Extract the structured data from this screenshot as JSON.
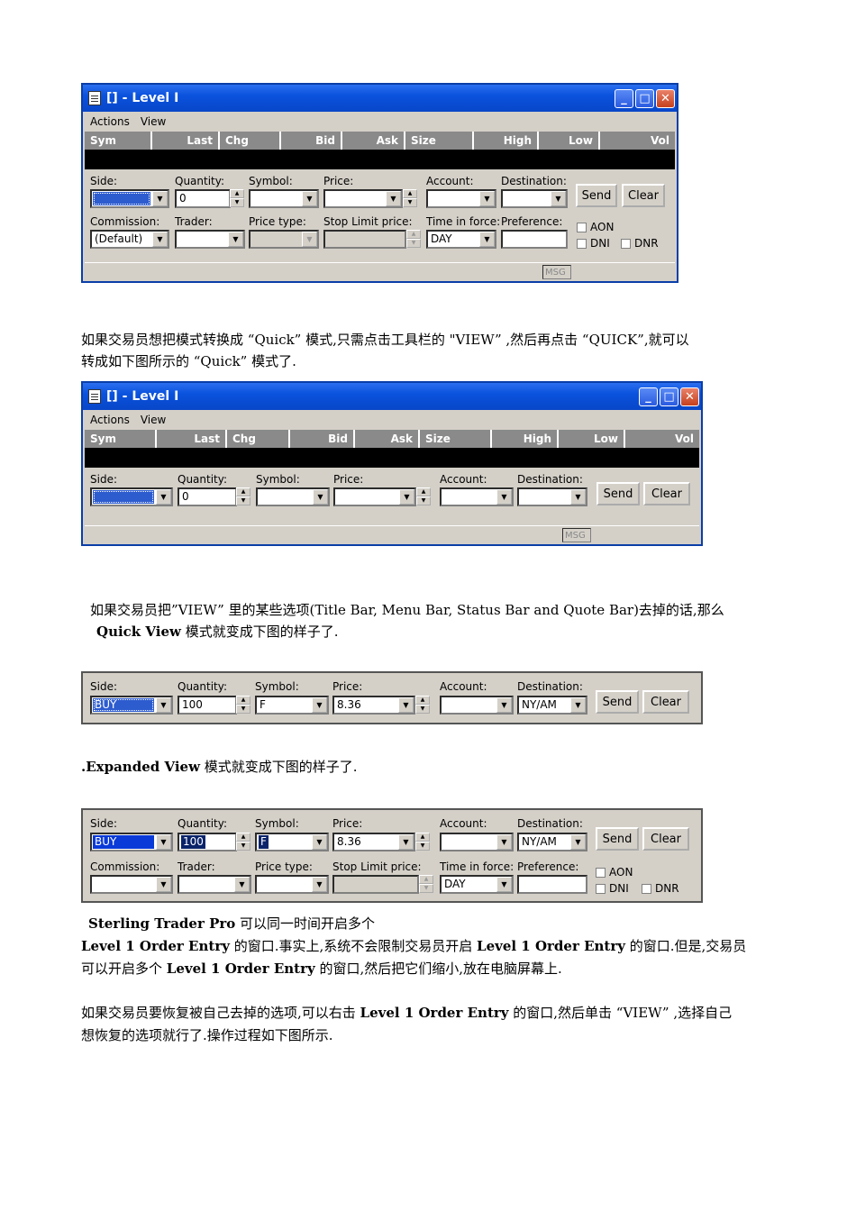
{
  "window": {
    "title": "[] - Level I",
    "menu": [
      "Actions",
      "View"
    ],
    "quote_columns": [
      "Sym",
      "Last",
      "Chg",
      "Bid",
      "Ask",
      "Size",
      "High",
      "Low",
      "Vol"
    ],
    "status_msg": "MSG"
  },
  "form": {
    "side_label": "Side:",
    "quantity_label": "Quantity:",
    "symbol_label": "Symbol:",
    "price_label": "Price:",
    "account_label": "Account:",
    "destination_label": "Destination:",
    "commission_label": "Commission:",
    "trader_label": "Trader:",
    "price_type_label": "Price type:",
    "stop_limit_label": "Stop Limit price:",
    "tif_label": "Time in force:",
    "preference_label": "Preference:",
    "send_label": "Send",
    "clear_label": "Clear",
    "aon_label": "AON",
    "dni_label": "DNI",
    "dnr_label": "DNR",
    "default_quantity": "0",
    "default_commission": "(Default)",
    "default_tif": "DAY"
  },
  "filled": {
    "side": "BUY",
    "quantity": "100",
    "symbol": "F",
    "price": "8.36",
    "destination": "NY/AM",
    "tif": "DAY"
  },
  "text": {
    "p1a": "如果交易员想把模式转换成 “Quick”   模式,只需点击工具栏的 \"VIEW” ,然后再点击 “QUICK”,就可以",
    "p1b": "转成如下图所示的 “Quick”   模式了.",
    "p2a": "如果交易员把”VIEW”    里的某些选项(Title Bar, Menu Bar, Status Bar and Quote Bar)去掉的话,那么",
    "p2b_bold": "Quick View",
    "p2b_rest": " 模式就变成下图的样子了.",
    "p3_bold": ".Expanded View",
    "p3_rest": " 模式就变成下图的样子了.",
    "p4_bold1": "Sterling Trader Pro",
    "p4_rest1": " 可以同一时间开启多个",
    "p4b_bold1": "Level 1 Order Entry",
    "p4b_mid": " 的窗口.事实上,系统不会限制交易员开启 ",
    "p4b_bold2": "Level 1 Order Entry",
    "p4b_rest": " 的窗口.但是,交易员",
    "p4c_pre": "可以开启多个 ",
    "p4c_bold": "Level 1 Order Entry",
    "p4c_rest": " 的窗口,然后把它们缩小,放在电脑屏幕上.",
    "p5a_pre": "如果交易员要恢复被自己去掉的选项,可以右击 ",
    "p5a_bold": "Level 1 Order Entry",
    "p5a_rest": " 的窗口,然后单击 “VIEW” ,选择自己",
    "p5b": "想恢复的选项就行了.操作过程如下图所示."
  }
}
